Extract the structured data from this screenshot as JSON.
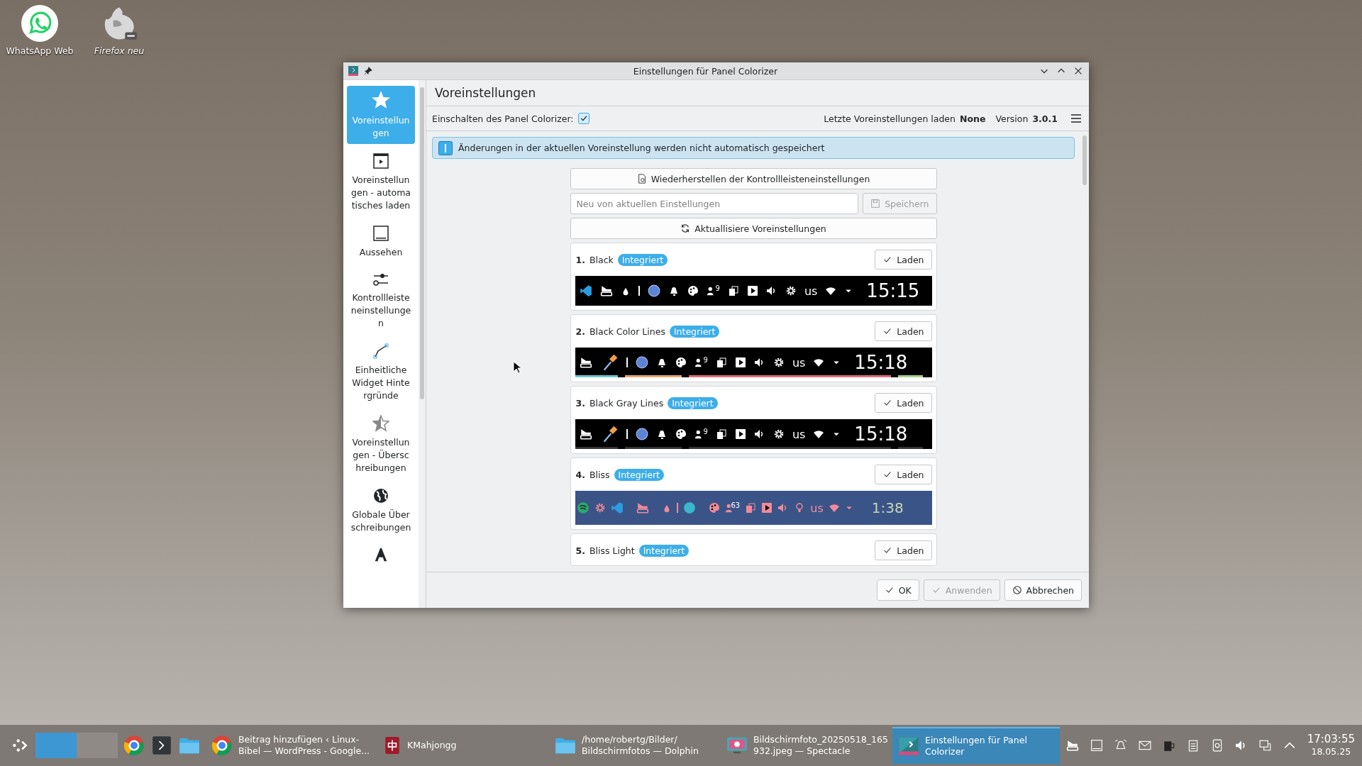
{
  "desktop_icons": [
    {
      "label": "WhatsApp Web",
      "is_link": false
    },
    {
      "label": "Firefox neu",
      "is_link": true
    }
  ],
  "window": {
    "title": "Einstellungen für Panel Colorizer"
  },
  "sidebar": {
    "items": [
      {
        "label": "Voreinstellungen",
        "selected": true
      },
      {
        "label": "Voreinstellungen - automatisches laden",
        "selected": false
      },
      {
        "label": "Aussehen",
        "selected": false
      },
      {
        "label": "Kontrollleisteneinstellungen",
        "selected": false
      },
      {
        "label": "Einheitliche Widget Hintergründe",
        "selected": false
      },
      {
        "label": "Voreinstellungen - Überschreibungen",
        "selected": false
      },
      {
        "label": "Globale Überschreibungen",
        "selected": false
      },
      {
        "selected": false
      }
    ]
  },
  "page": {
    "title": "Voreinstellungen",
    "enable_label": "Einschalten des Panel Colorizer:",
    "enabled": true,
    "last_preset_label": "Letzte Voreinstellungen laden",
    "last_preset": "None",
    "version_label": "Version",
    "version": "3.0.1"
  },
  "info_banner": "Änderungen in der aktuellen Voreinstellung werden nicht automatisch gespeichert",
  "restore_button": "Wiederherstellen der Kontrollleisteneinstellungen",
  "new_preset": {
    "placeholder": "Neu von aktuellen Einstellungen",
    "save_button": "Speichern",
    "save_disabled": true
  },
  "refresh_button": "Aktuallisiere Voreinstellungen",
  "presets": [
    {
      "number": "1.",
      "name": "Black",
      "badge": "Integriert",
      "load_button": "Laden",
      "preview": {
        "kind": "black",
        "badge": "9",
        "keyboard": "us",
        "clock": "15:15"
      }
    },
    {
      "number": "2.",
      "name": "Black Color Lines",
      "badge": "Integriert",
      "load_button": "Laden",
      "preview": {
        "kind": "color_lines",
        "badge": "9",
        "keyboard": "us",
        "clock": "15:18"
      }
    },
    {
      "number": "3.",
      "name": "Black Gray Lines",
      "badge": "Integriert",
      "load_button": "Laden",
      "preview": {
        "kind": "gray_lines",
        "badge": "9",
        "keyboard": "us",
        "clock": "15:18"
      }
    },
    {
      "number": "4.",
      "name": "Bliss",
      "badge": "Integriert",
      "load_button": "Laden",
      "preview": {
        "kind": "bliss",
        "badge": "63",
        "keyboard": "us",
        "clock": "1:38"
      }
    },
    {
      "number": "5.",
      "name": "Bliss Light",
      "badge": "Integriert",
      "load_button": "Laden"
    }
  ],
  "buttons": [
    {
      "label": "OK",
      "disabled": false,
      "kind": "ok"
    },
    {
      "label": "Anwenden",
      "disabled": true,
      "kind": "ok"
    },
    {
      "label": "Abbrechen",
      "disabled": false,
      "kind": "cancel"
    }
  ],
  "taskbar": {
    "pager": [
      {
        "selected": true
      },
      {
        "selected": false
      }
    ],
    "tasks": [
      {
        "kind": "browser",
        "lines": [
          "Beitrag hinzufügen ‹ Linux-",
          "Bibel — WordPress - Google..."
        ],
        "selected": false
      },
      {
        "kind": "game",
        "lines": [
          "KMahjongg"
        ],
        "selected": false
      },
      {
        "kind": "folder",
        "lines": [
          "/home/robertg/Bilder/",
          "Bildschirmfotos — Dolphin"
        ],
        "selected": false
      },
      {
        "kind": "screenshot",
        "lines": [
          "Bildschirmfoto_20250518_165",
          "932.jpeg — Spectacle"
        ],
        "selected": false
      },
      {
        "kind": "settings",
        "lines": [
          "Einstellungen für Panel",
          "Colorizer"
        ],
        "selected": true
      }
    ],
    "clock": {
      "time": "17:03:55",
      "date": "18.05.25"
    }
  }
}
